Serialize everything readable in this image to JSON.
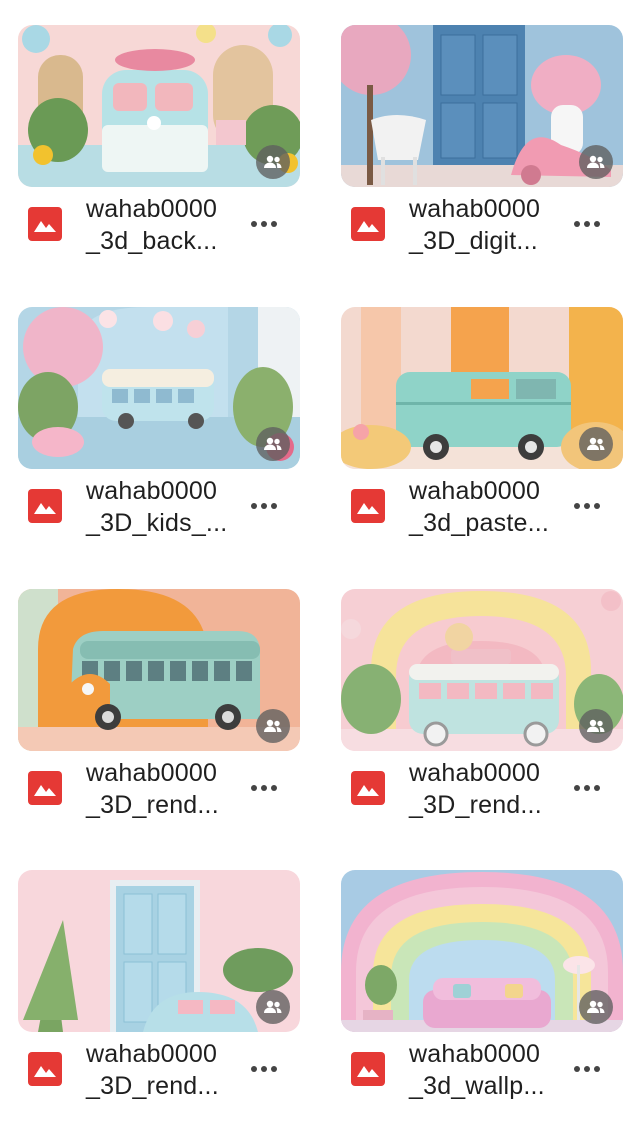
{
  "files": [
    {
      "name_line1": "wahab0000",
      "name_line2": "_3d_back...",
      "thumb_icon": "pastel-van-photo-icon"
    },
    {
      "name_line1": "wahab0000",
      "name_line2": "_3D_digit...",
      "thumb_icon": "blue-door-room-photo-icon"
    },
    {
      "name_line1": "wahab0000",
      "name_line2": "_3D_kids_...",
      "thumb_icon": "kids-van-room-photo-icon"
    },
    {
      "name_line1": "wahab0000",
      "name_line2": "_3d_paste...",
      "thumb_icon": "pastel-van-photo-icon"
    },
    {
      "name_line1": "wahab0000",
      "name_line2": "_3D_rend...",
      "thumb_icon": "orange-van-photo-icon"
    },
    {
      "name_line1": "wahab0000",
      "name_line2": "_3D_rend...",
      "thumb_icon": "rainbow-arch-van-photo-icon"
    },
    {
      "name_line1": "wahab0000",
      "name_line2": "_3D_rend...",
      "thumb_icon": "pink-door-car-photo-icon"
    },
    {
      "name_line1": "wahab0000",
      "name_line2": "_3d_wallp...",
      "thumb_icon": "rainbow-wallpaper-photo-icon"
    }
  ],
  "colors": {
    "file_icon_red": "#e53935",
    "shared_badge": "#5f5f5f"
  }
}
